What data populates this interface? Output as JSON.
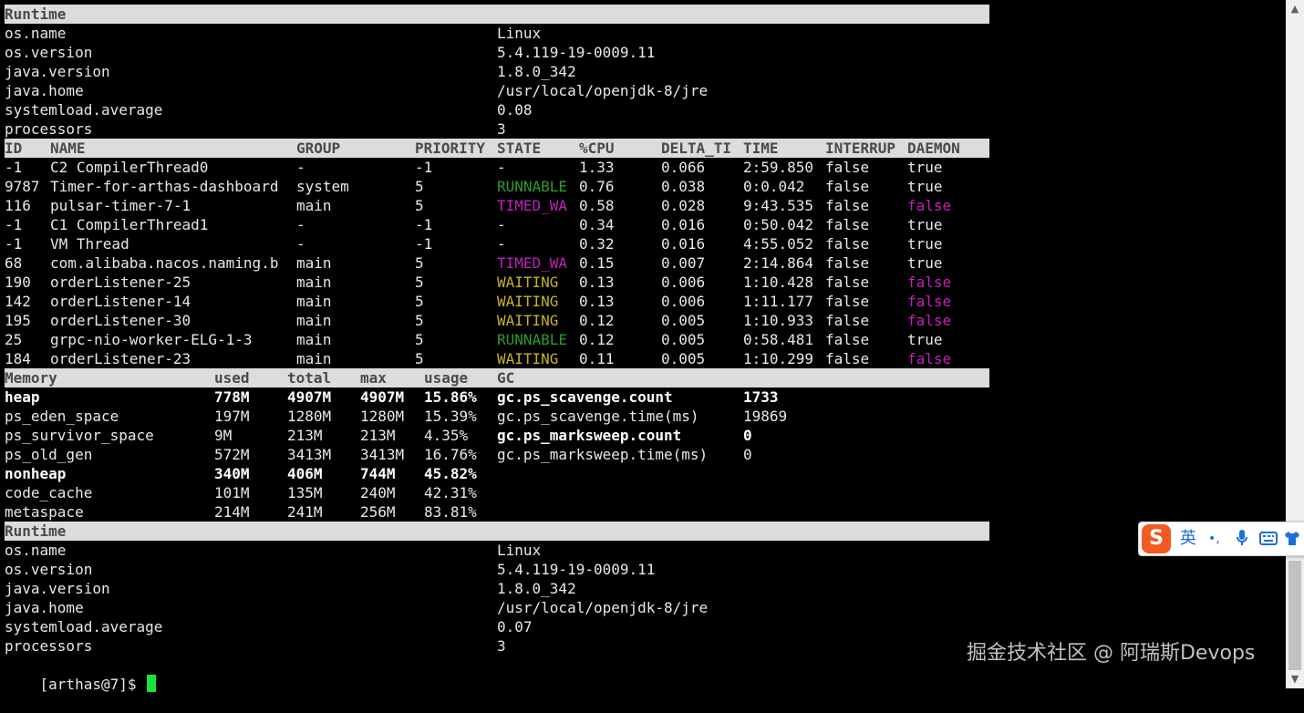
{
  "runtime_top": {
    "header": "Runtime",
    "rows": [
      {
        "key": "os.name",
        "value": "Linux"
      },
      {
        "key": "os.version",
        "value": "5.4.119-19-0009.11"
      },
      {
        "key": "java.version",
        "value": "1.8.0_342"
      },
      {
        "key": "java.home",
        "value": "/usr/local/openjdk-8/jre"
      },
      {
        "key": "systemload.average",
        "value": "0.08"
      },
      {
        "key": "processors",
        "value": "3"
      }
    ]
  },
  "threads": {
    "headers": [
      "ID",
      "NAME",
      "GROUP",
      "PRIORITY",
      "STATE",
      "%CPU",
      "DELTA_TI",
      "TIME",
      "INTERRUP",
      "DAEMON"
    ],
    "rows": [
      [
        "-1",
        "C2 CompilerThread0",
        "-",
        "-1",
        "-",
        "1.33",
        "0.066",
        "2:59.850",
        "false",
        "true"
      ],
      [
        "9787",
        "Timer-for-arthas-dashboard",
        "system",
        "5",
        "RUNNABLE",
        "0.76",
        "0.038",
        "0:0.042",
        "false",
        "true"
      ],
      [
        "116",
        "pulsar-timer-7-1",
        "main",
        "5",
        "TIMED_WA",
        "0.58",
        "0.028",
        "9:43.535",
        "false",
        "false"
      ],
      [
        "-1",
        "C1 CompilerThread1",
        "-",
        "-1",
        "-",
        "0.34",
        "0.016",
        "0:50.042",
        "false",
        "true"
      ],
      [
        "-1",
        "VM Thread",
        "-",
        "-1",
        "-",
        "0.32",
        "0.016",
        "4:55.052",
        "false",
        "true"
      ],
      [
        "68",
        "com.alibaba.nacos.naming.b",
        "main",
        "5",
        "TIMED_WA",
        "0.15",
        "0.007",
        "2:14.864",
        "false",
        "true"
      ],
      [
        "190",
        "orderListener-25",
        "main",
        "5",
        "WAITING",
        "0.13",
        "0.006",
        "1:10.428",
        "false",
        "false"
      ],
      [
        "142",
        "orderListener-14",
        "main",
        "5",
        "WAITING",
        "0.13",
        "0.006",
        "1:11.177",
        "false",
        "false"
      ],
      [
        "195",
        "orderListener-30",
        "main",
        "5",
        "WAITING",
        "0.12",
        "0.005",
        "1:10.933",
        "false",
        "false"
      ],
      [
        "25",
        "grpc-nio-worker-ELG-1-3",
        "main",
        "5",
        "RUNNABLE",
        "0.12",
        "0.005",
        "0:58.481",
        "false",
        "true"
      ],
      [
        "184",
        "orderListener-23",
        "main",
        "5",
        "WAITING",
        "0.11",
        "0.005",
        "1:10.299",
        "false",
        "false"
      ]
    ]
  },
  "memory": {
    "headers": [
      "Memory",
      "used",
      "total",
      "max",
      "usage",
      "GC"
    ],
    "rows": [
      {
        "name": "heap",
        "used": "778M",
        "total": "4907M",
        "max": "4907M",
        "usage": "15.86%",
        "gc_key": "gc.ps_scavenge.count",
        "gc_val": "1733",
        "bold": true
      },
      {
        "name": "ps_eden_space",
        "used": "197M",
        "total": "1280M",
        "max": "1280M",
        "usage": "15.39%",
        "gc_key": "gc.ps_scavenge.time(ms)",
        "gc_val": "19869",
        "bold": false
      },
      {
        "name": "ps_survivor_space",
        "used": "9M",
        "total": "213M",
        "max": "213M",
        "usage": "4.35%",
        "gc_key": "gc.ps_marksweep.count",
        "gc_val": "0",
        "bold": false,
        "gc_bold": true
      },
      {
        "name": "ps_old_gen",
        "used": "572M",
        "total": "3413M",
        "max": "3413M",
        "usage": "16.76%",
        "gc_key": "gc.ps_marksweep.time(ms)",
        "gc_val": "0",
        "bold": false
      },
      {
        "name": "nonheap",
        "used": "340M",
        "total": "406M",
        "max": "744M",
        "usage": "45.82%",
        "gc_key": "",
        "gc_val": "",
        "bold": true
      },
      {
        "name": "code_cache",
        "used": "101M",
        "total": "135M",
        "max": "240M",
        "usage": "42.31%",
        "gc_key": "",
        "gc_val": "",
        "bold": false
      },
      {
        "name": "metaspace",
        "used": "214M",
        "total": "241M",
        "max": "256M",
        "usage": "83.81%",
        "gc_key": "",
        "gc_val": "",
        "bold": false
      }
    ]
  },
  "runtime_bottom": {
    "header": "Runtime",
    "rows": [
      {
        "key": "os.name",
        "value": "Linux"
      },
      {
        "key": "os.version",
        "value": "5.4.119-19-0009.11"
      },
      {
        "key": "java.version",
        "value": "1.8.0_342"
      },
      {
        "key": "java.home",
        "value": "/usr/local/openjdk-8/jre"
      },
      {
        "key": "systemload.average",
        "value": "0.07"
      },
      {
        "key": "processors",
        "value": "3"
      }
    ]
  },
  "prompt": "[arthas@7]$ ",
  "state_colors": {
    "RUNNABLE": "#2e9b2e",
    "TIMED_WA": "#c21fc2",
    "WAITING": "#c8b02a"
  },
  "daemon_false_color": "#c21fc2",
  "ime": {
    "logo": "S",
    "lang": "英",
    "punct": "•,",
    "mic": "microphone-icon",
    "keyboard": "keyboard-icon",
    "shirt": "shirt-icon"
  },
  "watermark": "掘金技术社区 @ 阿瑞斯Devops",
  "scrollbar": {
    "up": "▲",
    "down": "▼"
  }
}
